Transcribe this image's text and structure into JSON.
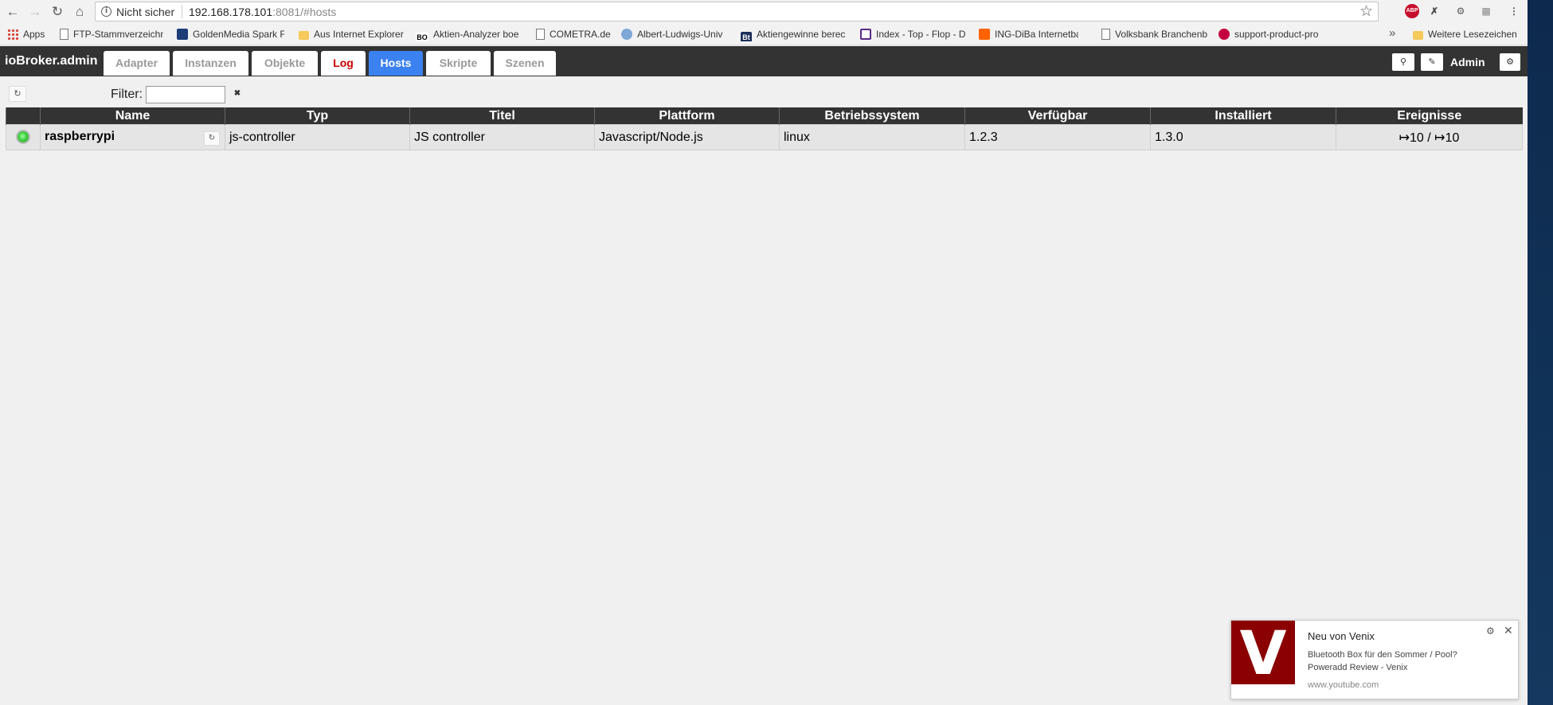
{
  "browser": {
    "security_label": "Nicht sicher",
    "url_host": "192.168.178.101",
    "url_rest": ":8081/#hosts",
    "bookmarks": [
      {
        "label": "Apps",
        "icon": "apps-icon"
      },
      {
        "label": "FTP-Stammverzeichn",
        "icon": "page-icon"
      },
      {
        "label": "GoldenMedia Spark F",
        "icon": "goldenmedia-icon"
      },
      {
        "label": "Aus Internet Explorer",
        "icon": "folder-icon"
      },
      {
        "label": "Aktien-Analyzer  boe",
        "icon": "bo-icon"
      },
      {
        "label": "COMETRA.de",
        "icon": "page-icon"
      },
      {
        "label": "Albert-Ludwigs-Univ",
        "icon": "globe-icon"
      },
      {
        "label": "Aktiengewinne berec",
        "icon": "bt-icon"
      },
      {
        "label": "Index - Top - Flop - D",
        "icon": "index-icon"
      },
      {
        "label": "ING-DiBa Internetbar",
        "icon": "ing-icon"
      },
      {
        "label": "Volksbank Branchenb",
        "icon": "page-icon"
      },
      {
        "label": "support-product-pro",
        "icon": "lg-icon"
      }
    ],
    "more_bookmarks": "Weitere Lesezeichen"
  },
  "app": {
    "brand": "ioBroker.admin",
    "tabs": [
      {
        "label": "Adapter",
        "state": "normal"
      },
      {
        "label": "Instanzen",
        "state": "normal"
      },
      {
        "label": "Objekte",
        "state": "normal"
      },
      {
        "label": "Log",
        "state": "log"
      },
      {
        "label": "Hosts",
        "state": "active"
      },
      {
        "label": "Skripte",
        "state": "normal"
      },
      {
        "label": "Szenen",
        "state": "normal"
      }
    ],
    "user_label": "Admin"
  },
  "toolbar": {
    "filter_label": "Filter:",
    "filter_value": ""
  },
  "table": {
    "columns": [
      "",
      "Name",
      "Typ",
      "Titel",
      "Plattform",
      "Betriebssystem",
      "Verfügbar",
      "Installiert",
      "Ereignisse"
    ],
    "rows": [
      {
        "status": "online",
        "name": "raspberrypi",
        "type": "js-controller",
        "title": "JS controller",
        "platform": "Javascript/Node.js",
        "os": "linux",
        "available": "1.2.3",
        "installed": "1.3.0",
        "events": "↦10 / ↦10"
      }
    ]
  },
  "notification": {
    "logo_letter": "V",
    "title": "Neu von Venix",
    "body": "Bluetooth Box für den Sommer / Pool? Poweradd Review - Venix",
    "source": "www.youtube.com"
  },
  "colors": {
    "header_bg": "#333333",
    "active_tab": "#3b82f0",
    "log_tab": "#cc0000",
    "status_online": "#44cc44"
  }
}
